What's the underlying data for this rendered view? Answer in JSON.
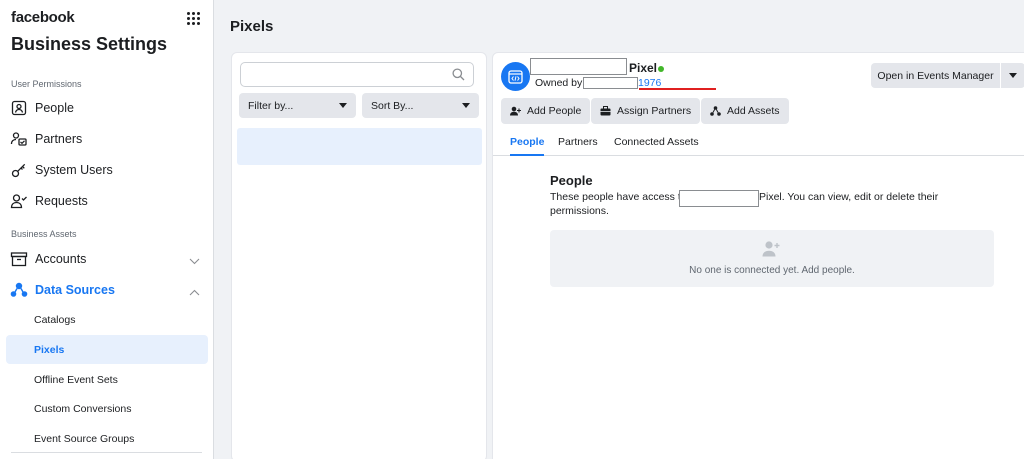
{
  "brand": "facebook",
  "app_title": "Business Settings",
  "sidebar": {
    "user_permissions_label": "User Permissions",
    "people": "People",
    "partners": "Partners",
    "system_users": "System Users",
    "requests": "Requests",
    "business_assets_label": "Business Assets",
    "accounts": "Accounts",
    "data_sources": "Data Sources",
    "sub_items": [
      "Catalogs",
      "Pixels",
      "Offline Event Sets",
      "Custom Conversions",
      "Event Source Groups"
    ]
  },
  "page_title": "Pixels",
  "list": {
    "search_placeholder": "",
    "filter_label": "Filter by...",
    "sort_label": "Sort By..."
  },
  "detail": {
    "pixel_label": "Pixel",
    "owned_by_label": "Owned by:",
    "owner_id": "1976",
    "events_manager_button": "Open in Events Manager",
    "actions": {
      "add_people": "Add People",
      "assign_partners": "Assign Partners",
      "add_assets": "Add Assets"
    },
    "tabs": [
      "People",
      "Partners",
      "Connected Assets"
    ],
    "people_heading": "People",
    "desc_part1": "These people have access to",
    "desc_part2": "Pixel. You can view, edit or delete their",
    "desc_part3": "permissions.",
    "empty_message": "No one is connected yet. Add people."
  },
  "colors": {
    "accent": "#1877f2",
    "status_active": "#42b72a",
    "selected_bg": "#e7f0fd"
  }
}
